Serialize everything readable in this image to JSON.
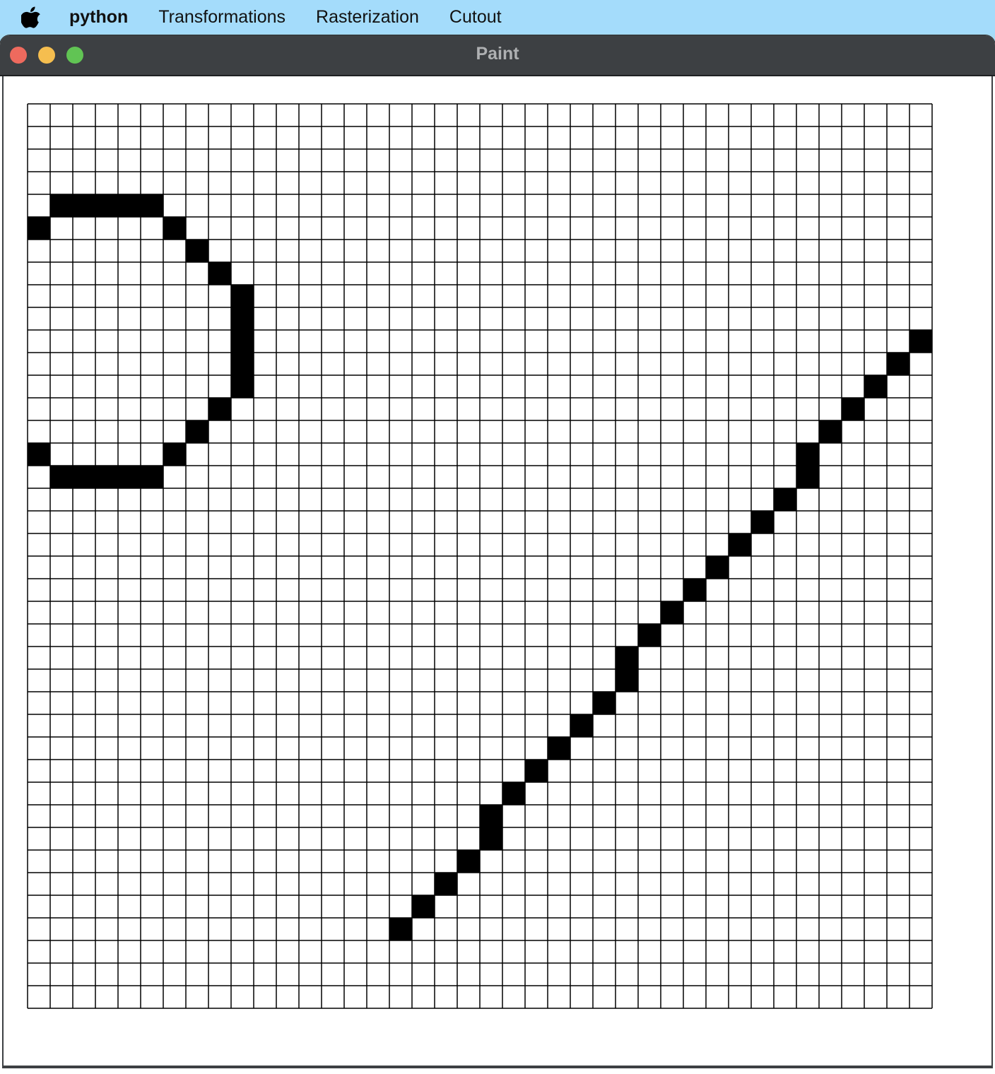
{
  "menubar": {
    "apple_icon": "apple-logo-icon",
    "items": [
      {
        "label": "python"
      },
      {
        "label": "Transformations"
      },
      {
        "label": "Rasterization"
      },
      {
        "label": "Cutout"
      }
    ]
  },
  "window": {
    "title": "Paint",
    "buttons": [
      "close",
      "minimize",
      "zoom"
    ]
  },
  "grid": {
    "columns": 40,
    "rows": 40,
    "filled_color": "#000000",
    "empty_color": "#ffffff",
    "line_color": "#000000",
    "filled_cells": [
      [
        1,
        4
      ],
      [
        2,
        4
      ],
      [
        3,
        4
      ],
      [
        4,
        4
      ],
      [
        5,
        4
      ],
      [
        0,
        5
      ],
      [
        6,
        5
      ],
      [
        7,
        6
      ],
      [
        8,
        7
      ],
      [
        9,
        8
      ],
      [
        9,
        9
      ],
      [
        9,
        10
      ],
      [
        9,
        11
      ],
      [
        9,
        12
      ],
      [
        8,
        13
      ],
      [
        7,
        14
      ],
      [
        0,
        15
      ],
      [
        6,
        15
      ],
      [
        1,
        16
      ],
      [
        2,
        16
      ],
      [
        3,
        16
      ],
      [
        4,
        16
      ],
      [
        5,
        16
      ],
      [
        39,
        10
      ],
      [
        38,
        11
      ],
      [
        37,
        12
      ],
      [
        36,
        13
      ],
      [
        35,
        14
      ],
      [
        34,
        15
      ],
      [
        34,
        16
      ],
      [
        33,
        17
      ],
      [
        32,
        18
      ],
      [
        31,
        19
      ],
      [
        30,
        20
      ],
      [
        29,
        21
      ],
      [
        28,
        22
      ],
      [
        27,
        23
      ],
      [
        26,
        24
      ],
      [
        26,
        25
      ],
      [
        25,
        26
      ],
      [
        24,
        27
      ],
      [
        23,
        28
      ],
      [
        22,
        29
      ],
      [
        21,
        30
      ],
      [
        20,
        31
      ],
      [
        20,
        32
      ],
      [
        19,
        33
      ],
      [
        18,
        34
      ],
      [
        17,
        35
      ],
      [
        16,
        36
      ]
    ]
  }
}
